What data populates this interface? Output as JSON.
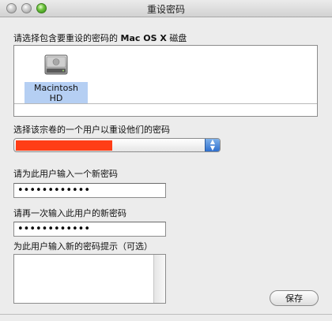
{
  "window": {
    "title": "重设密码"
  },
  "disk_section": {
    "prompt_prefix": "请选择包含要重设的密码的",
    "prompt_bold": "Mac OS X",
    "prompt_suffix": "磁盘",
    "disks": [
      {
        "name": "Macintosh HD",
        "icon": "hard-drive-icon",
        "selected": true
      }
    ]
  },
  "user_section": {
    "prompt": "选择该宗卷的一个用户以重设他们的密码",
    "selected_user": ""
  },
  "new_password": {
    "label": "请为此用户输入一个新密码",
    "value": "••••••••••••"
  },
  "confirm_password": {
    "label": "请再一次输入此用户的新密码",
    "value": "••••••••••••"
  },
  "hint": {
    "label": "为此用户输入新的密码提示（可选）",
    "value": ""
  },
  "buttons": {
    "save": "保存"
  },
  "colors": {
    "selection": "#b5cff3",
    "redaction": "#ff3d16",
    "popup_accent": "#2f6fce"
  }
}
